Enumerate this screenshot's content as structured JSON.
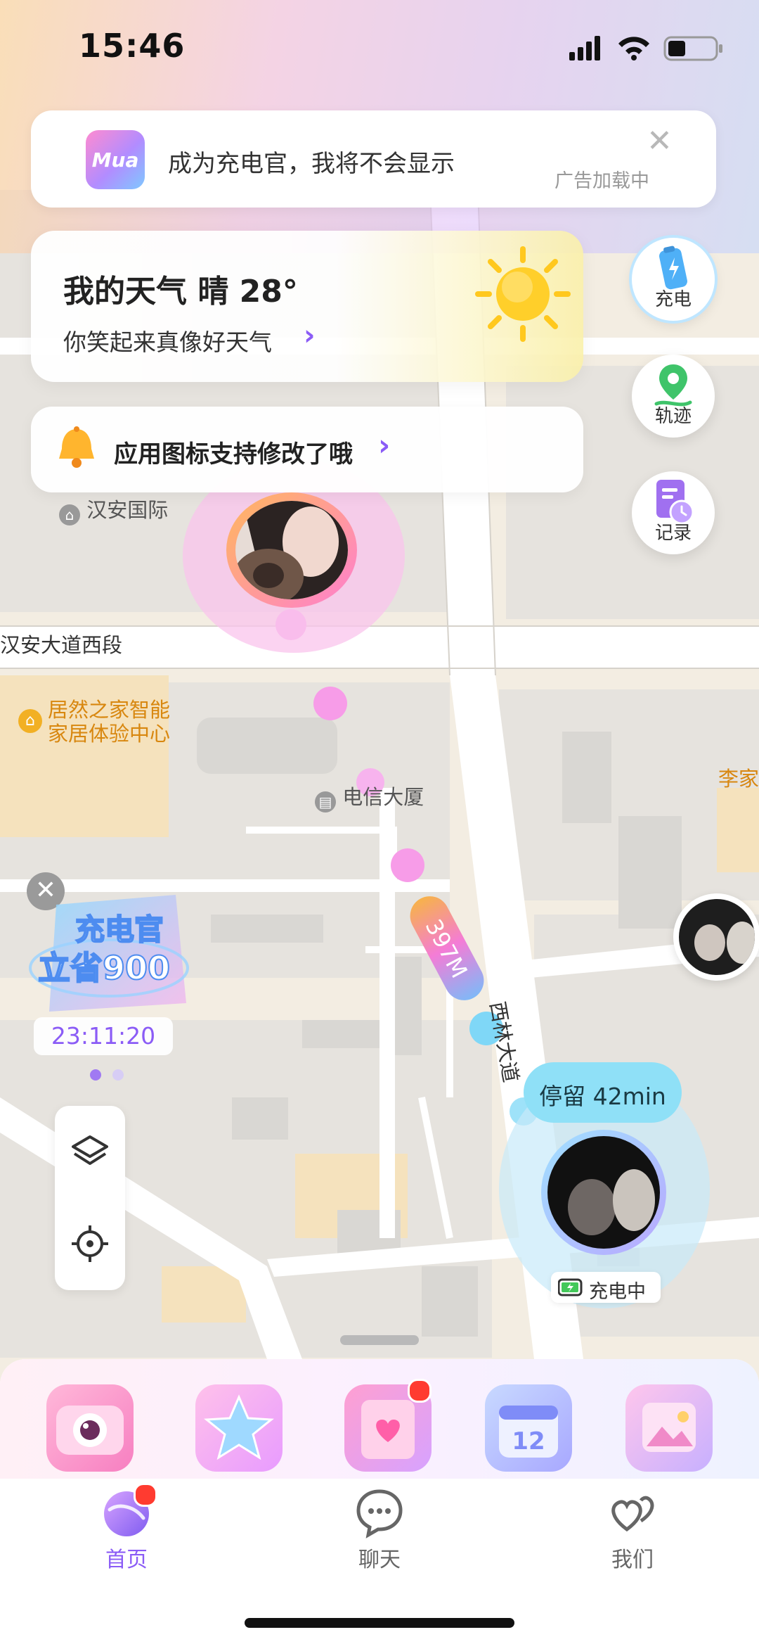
{
  "status_bar": {
    "time": "15:46"
  },
  "ad_banner": {
    "logo_text": "Mua",
    "text": "成为充电官，我将不会显示",
    "close_glyph": "✕",
    "loading_text": "广告加载中"
  },
  "weather": {
    "title": "我的天气 晴 28°",
    "subtitle": "你笑起来真像好天气",
    "chevron": "›"
  },
  "notice": {
    "text": "应用图标支持修改了哦",
    "chevron": "›"
  },
  "side_actions": {
    "charge_label": "充电",
    "track_label": "轨迹",
    "record_label": "记录"
  },
  "map": {
    "labels": {
      "hanan_intl": "汉安国际",
      "hanan_road": "汉安大道西段",
      "poi_line1": "居然之家智能",
      "poi_line2": "家居体验中心",
      "telecom": "电信大厦",
      "lijia": "李家",
      "xilin_road": "西林大道"
    },
    "distance": "397M",
    "stay": "停留 42min",
    "charging": "充电中"
  },
  "promo": {
    "close_glyph": "✕",
    "line1": "充电官",
    "line2": "立省900",
    "timer": "23:11:20"
  },
  "tabs": [
    {
      "label": "首页",
      "active": true
    },
    {
      "label": "聊天",
      "active": false
    },
    {
      "label": "我们",
      "active": false
    }
  ],
  "colors": {
    "accent": "#8b5cf6",
    "stay_bubble": "#8fe0f7",
    "badge": "#ff3b30"
  }
}
